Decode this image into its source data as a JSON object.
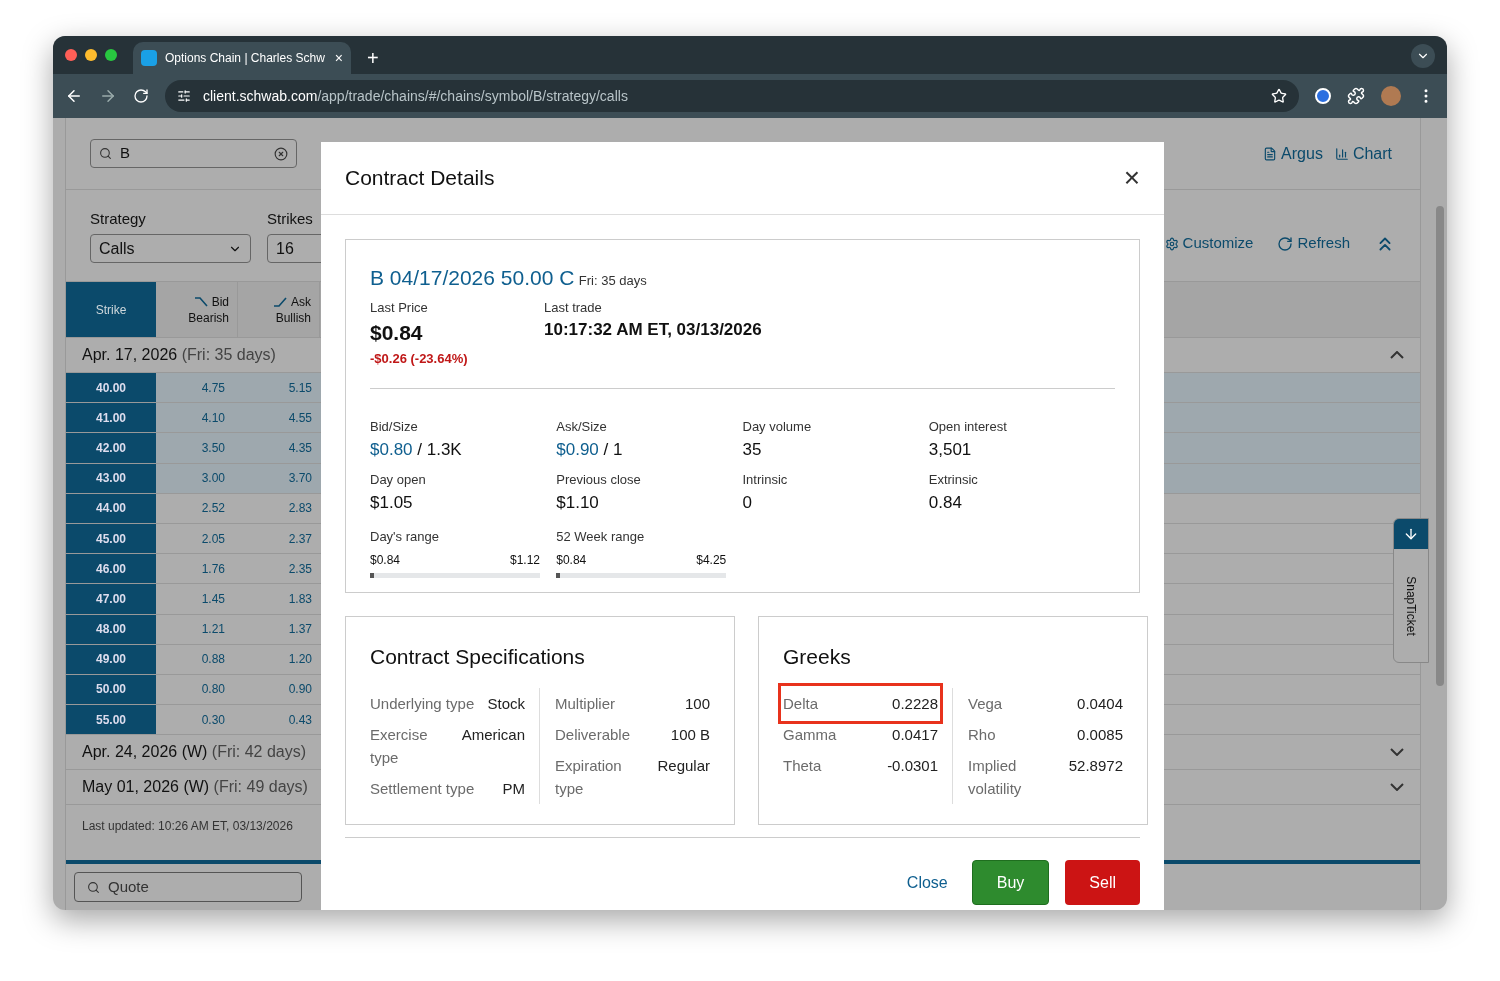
{
  "browser": {
    "tab_title": "Options Chain | Charles Schw",
    "tab_close": "×",
    "new_tab": "+",
    "url_host": "client.schwab.com",
    "url_path": "/app/trade/chains/#/chains/symbol/B/strategy/calls"
  },
  "app": {
    "search_value": "B",
    "links": [
      "Argus",
      "Chart"
    ],
    "strategy_label": "Strategy",
    "strategy_value": "Calls",
    "strikes_label": "Strikes",
    "strikes_value": "16",
    "actions": [
      "Customize",
      "Refresh"
    ],
    "columns": [
      {
        "label": "Strike",
        "kind": "strike"
      },
      {
        "label": "Bid",
        "sub": "Bearish",
        "kind": "bearish"
      },
      {
        "label": "Ask",
        "sub": "Bullish",
        "kind": "bullish"
      }
    ],
    "expirations": [
      {
        "date": "Apr. 17, 2026",
        "note": "(Fri: 35 days)",
        "expanded": true,
        "rows": [
          {
            "strike": "40.00",
            "bid": "4.75",
            "ask": "5.15",
            "in_the_money": true
          },
          {
            "strike": "41.00",
            "bid": "4.10",
            "ask": "4.55",
            "in_the_money": true
          },
          {
            "strike": "42.00",
            "bid": "3.50",
            "ask": "4.35",
            "in_the_money": true
          },
          {
            "strike": "43.00",
            "bid": "3.00",
            "ask": "3.70",
            "in_the_money": true
          },
          {
            "strike": "44.00",
            "bid": "2.52",
            "ask": "2.83",
            "in_the_money": false
          },
          {
            "strike": "45.00",
            "bid": "2.05",
            "ask": "2.37",
            "in_the_money": false
          },
          {
            "strike": "46.00",
            "bid": "1.76",
            "ask": "2.35",
            "in_the_money": false
          },
          {
            "strike": "47.00",
            "bid": "1.45",
            "ask": "1.83",
            "in_the_money": false
          },
          {
            "strike": "48.00",
            "bid": "1.21",
            "ask": "1.37",
            "in_the_money": false
          },
          {
            "strike": "49.00",
            "bid": "0.88",
            "ask": "1.20",
            "in_the_money": false
          },
          {
            "strike": "50.00",
            "bid": "0.80",
            "ask": "0.90",
            "in_the_money": false
          },
          {
            "strike": "55.00",
            "bid": "0.30",
            "ask": "0.43",
            "in_the_money": false
          }
        ]
      },
      {
        "date": "Apr. 24, 2026 (W)",
        "note": "(Fri: 42 days)",
        "expanded": false
      },
      {
        "date": "May 01, 2026 (W)",
        "note": "(Fri: 49 days)",
        "expanded": false
      }
    ],
    "last_updated": "Last updated: 10:26 AM ET, 03/13/2026",
    "quote_placeholder": "Quote",
    "snap_ticket": "SnapTicket"
  },
  "modal": {
    "title": "Contract Details",
    "close_icon": "×",
    "contract": "B 04/17/2026 50.00 C",
    "contract_days": "Fri: 35 days",
    "last_price_label": "Last Price",
    "last_price": "$0.84",
    "change": "-$0.26 (-23.64%)",
    "last_trade_label": "Last trade",
    "last_trade": "10:17:32 AM ET, 03/13/2026",
    "stats": [
      {
        "label": "Bid/Size",
        "price": "$0.80",
        "size": "/ 1.3K"
      },
      {
        "label": "Ask/Size",
        "price": "$0.90",
        "size": "/ 1"
      },
      {
        "label": "Day volume",
        "value": "35"
      },
      {
        "label": "Open interest",
        "value": "3,501"
      },
      {
        "label": "Day open",
        "value": "$1.05"
      },
      {
        "label": "Previous close",
        "value": "$1.10"
      },
      {
        "label": "Intrinsic",
        "value": "0"
      },
      {
        "label": "Extrinsic",
        "value": "0.84"
      }
    ],
    "ranges": [
      {
        "label": "Day's range",
        "low": "$0.84",
        "high": "$1.12",
        "level": 0.02
      },
      {
        "label": "52 Week range",
        "low": "$0.84",
        "high": "$4.25",
        "level": 0.02
      }
    ],
    "specs_title": "Contract Specifications",
    "specs_left": [
      {
        "label": "Underlying type",
        "value": "Stock"
      },
      {
        "label": "Exercise type",
        "value": "American"
      },
      {
        "label": "Settlement type",
        "value": "PM"
      }
    ],
    "specs_right": [
      {
        "label": "Multiplier",
        "value": "100"
      },
      {
        "label": "Deliverable",
        "value": "100 B"
      },
      {
        "label": "Expiration type",
        "value": "Regular"
      }
    ],
    "greeks_title": "Greeks",
    "greeks_left": [
      {
        "label": "Delta",
        "value": "0.2228",
        "highlighted": true
      },
      {
        "label": "Gamma",
        "value": "0.0417",
        "highlighted": false
      },
      {
        "label": "Theta",
        "value": "-0.0301",
        "highlighted": false
      }
    ],
    "greeks_right": [
      {
        "label": "Vega",
        "value": "0.0404",
        "highlighted": false
      },
      {
        "label": "Rho",
        "value": "0.0085",
        "highlighted": false
      },
      {
        "label": "Implied volatility",
        "value": "52.8972",
        "highlighted": false
      }
    ],
    "buttons": [
      {
        "label": "Close",
        "kind": "link"
      },
      {
        "label": "Buy",
        "kind": "buy"
      },
      {
        "label": "Sell",
        "kind": "sell"
      }
    ]
  }
}
